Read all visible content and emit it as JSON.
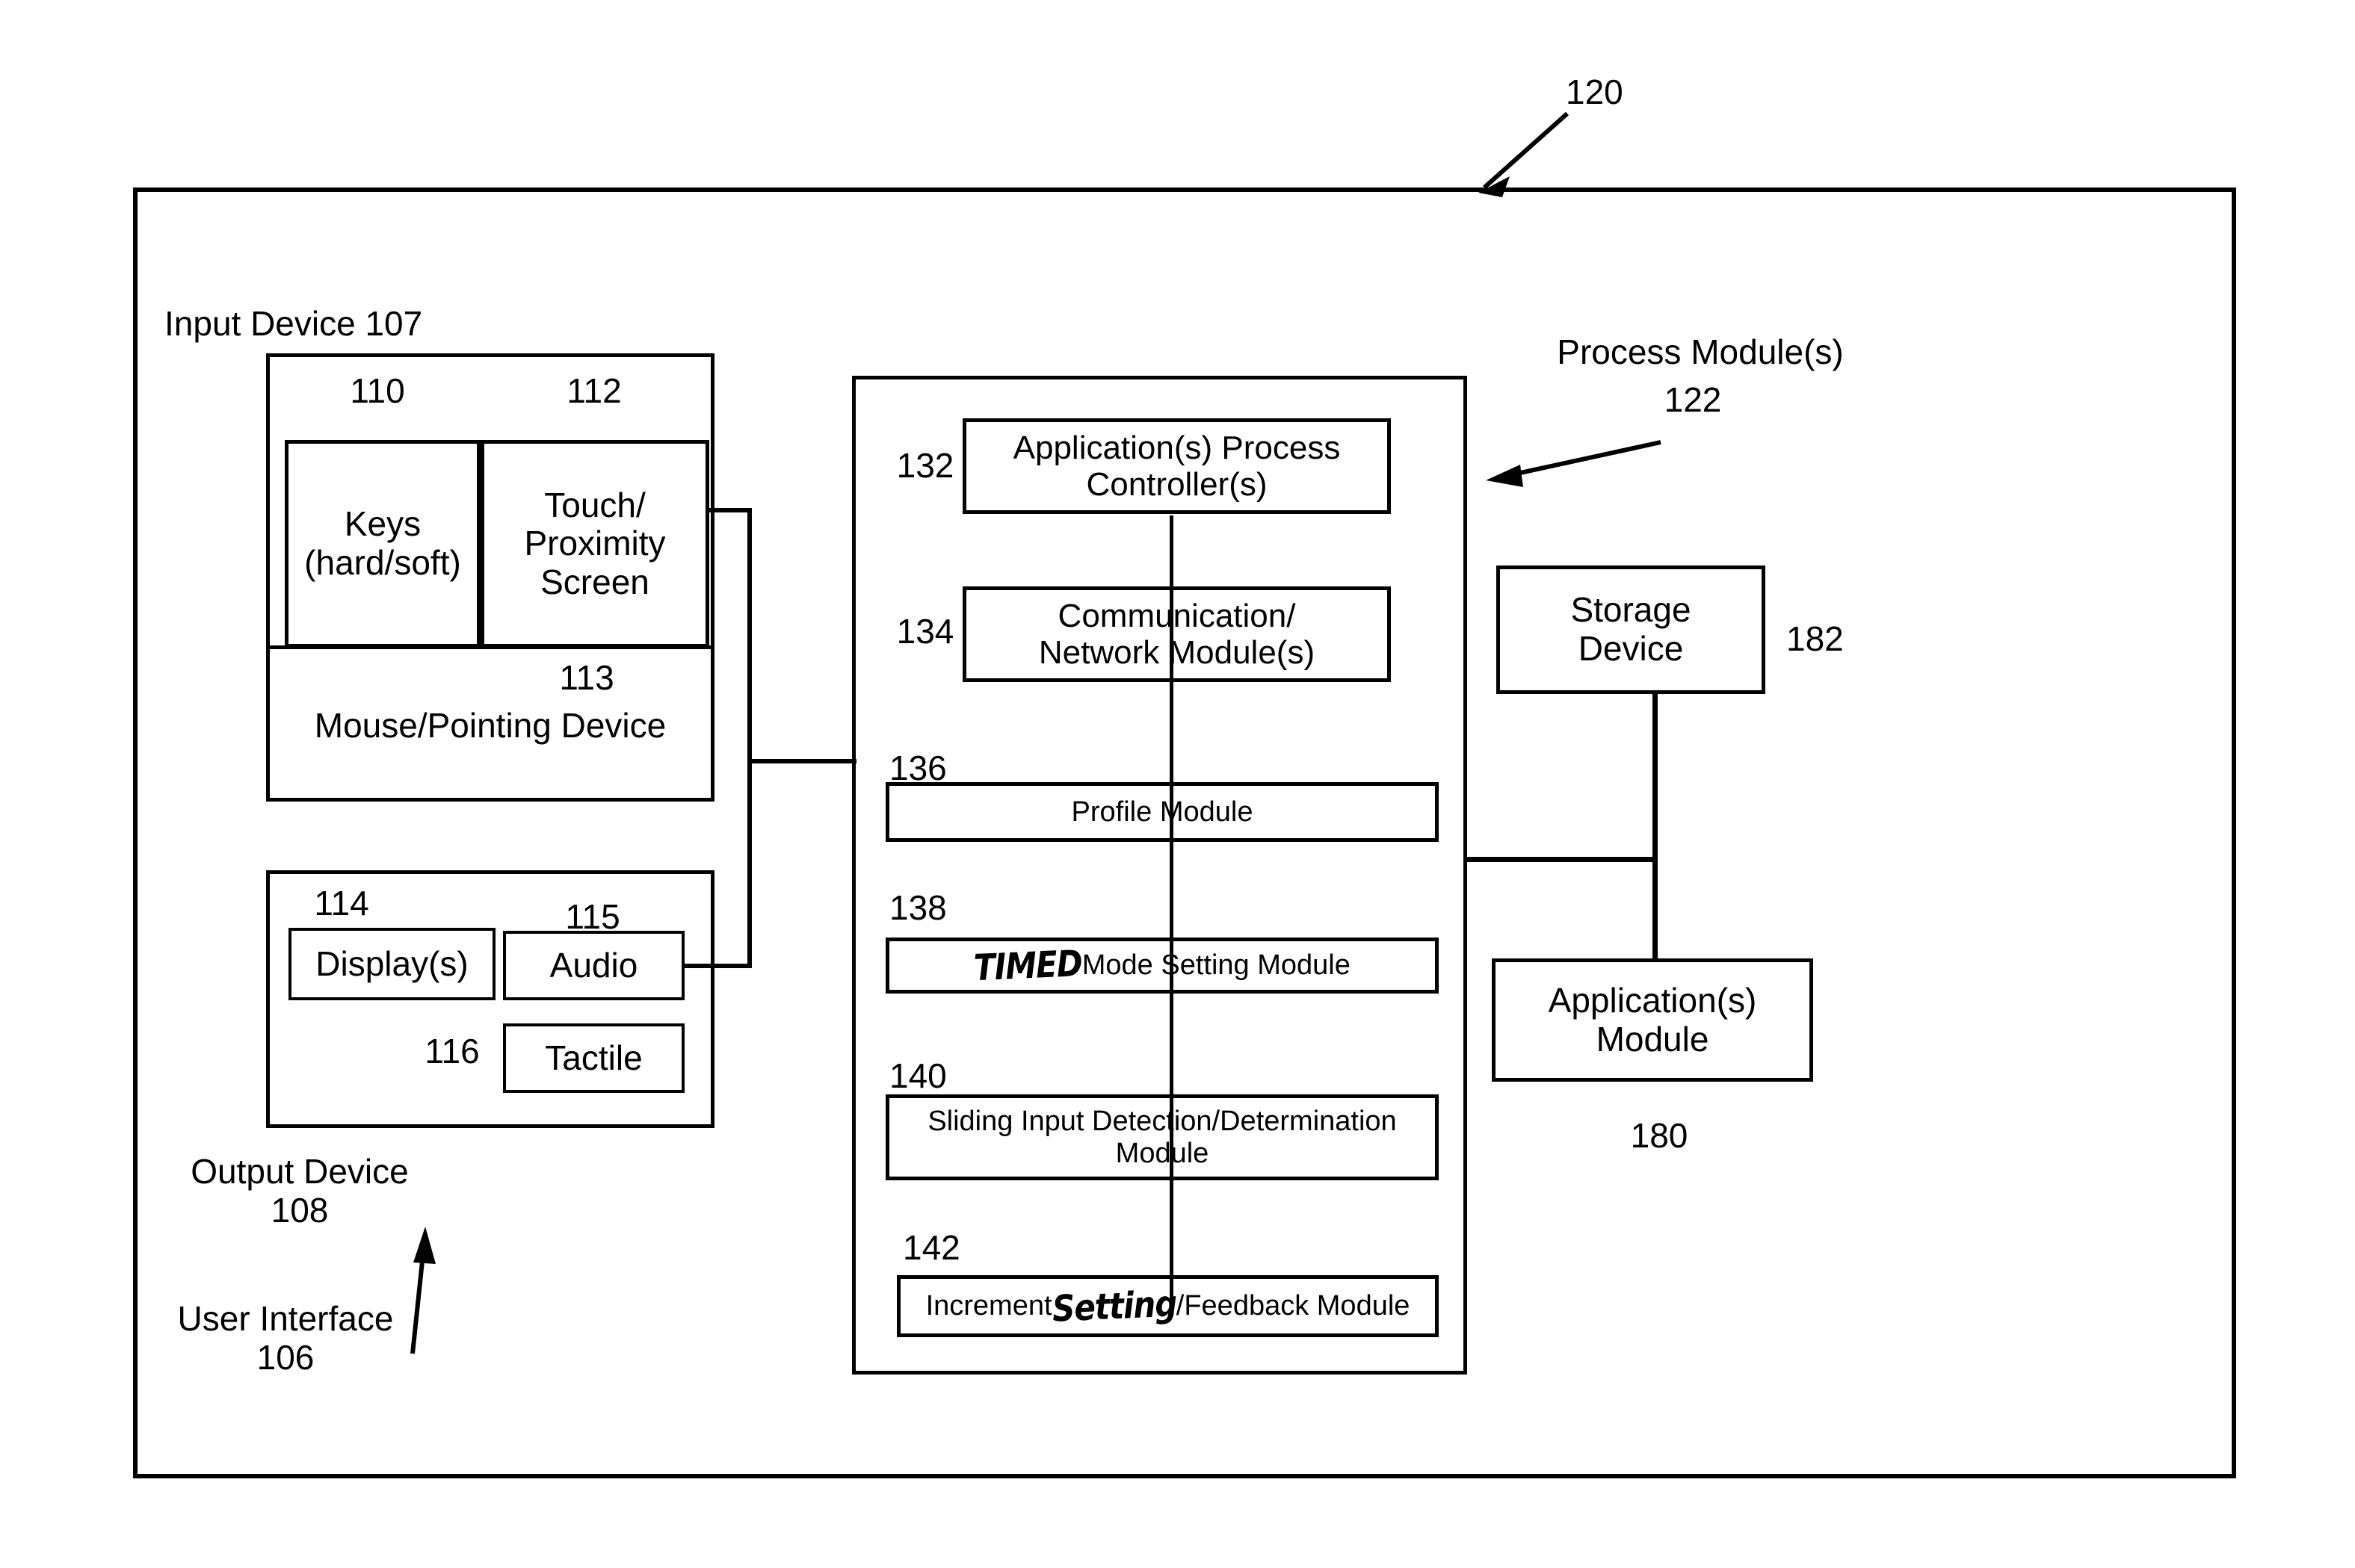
{
  "figure": {
    "reference_numeral": "120",
    "outer_frame_name": "system-boundary"
  },
  "input_device": {
    "title": "Input Device 107",
    "items": [
      {
        "ref": "110",
        "label": "Keys\n(hard/soft)"
      },
      {
        "ref": "112",
        "label": "Touch/\nProximity\nScreen"
      },
      {
        "ref": "113",
        "label": "Mouse/Pointing Device"
      }
    ]
  },
  "output_device": {
    "title": "Output Device\n108",
    "items": [
      {
        "ref": "114",
        "label": "Display(s)"
      },
      {
        "ref": "115",
        "label": "Audio"
      },
      {
        "ref": "116",
        "label": "Tactile"
      }
    ]
  },
  "user_interface": {
    "title": "User Interface\n106"
  },
  "process_modules": {
    "title": "Process Module(s)",
    "ref": "122",
    "modules": [
      {
        "ref": "132",
        "label": "Application(s) Process\nController(s)",
        "handwritten_prefix": "",
        "handwritten_mid": ""
      },
      {
        "ref": "134",
        "label": "Communication/\nNetwork Module(s)",
        "handwritten_prefix": "",
        "handwritten_mid": ""
      },
      {
        "ref": "136",
        "label": "Profile Module",
        "handwritten_prefix": "",
        "handwritten_mid": ""
      },
      {
        "ref": "138",
        "label": " Mode Setting Module",
        "handwritten_prefix": "TIMED",
        "handwritten_mid": ""
      },
      {
        "ref": "140",
        "label": "Sliding Input Detection/Determination\nModule",
        "handwritten_prefix": "",
        "handwritten_mid": ""
      },
      {
        "ref": "142",
        "label": "Increment ",
        "handwritten_prefix": "",
        "handwritten_mid": "Setting",
        "label_tail": "/Feedback Module"
      }
    ]
  },
  "storage": {
    "label": "Storage\nDevice",
    "ref": "182"
  },
  "applications": {
    "label": "Application(s)\nModule",
    "ref": "180"
  },
  "colors": {
    "line": "#000000",
    "background": "#ffffff"
  }
}
